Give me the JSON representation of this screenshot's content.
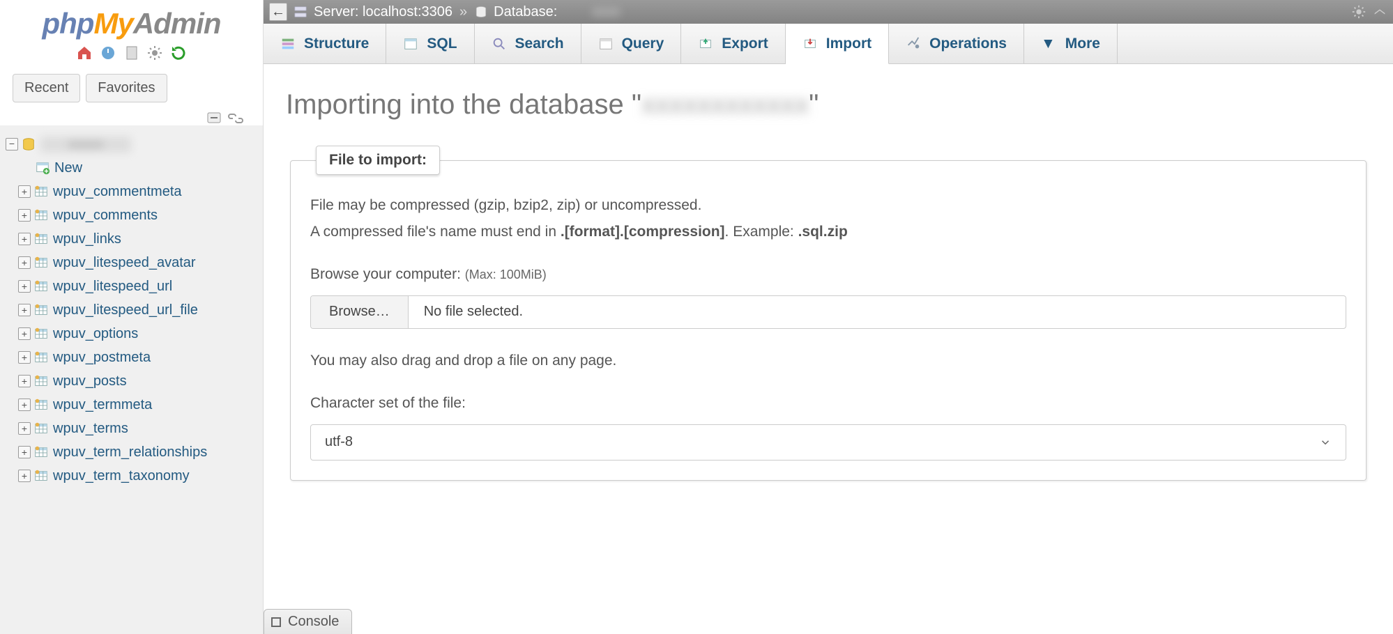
{
  "logo": {
    "p1": "php",
    "p2": "My",
    "p3": "Admin"
  },
  "sidebar": {
    "tabs": {
      "recent": "Recent",
      "favorites": "Favorites"
    },
    "new_label": "New",
    "tables": [
      "wpuv_commentmeta",
      "wpuv_comments",
      "wpuv_links",
      "wpuv_litespeed_avatar",
      "wpuv_litespeed_url",
      "wpuv_litespeed_url_file",
      "wpuv_options",
      "wpuv_postmeta",
      "wpuv_posts",
      "wpuv_termmeta",
      "wpuv_terms",
      "wpuv_term_relationships",
      "wpuv_term_taxonomy"
    ]
  },
  "breadcrumb": {
    "server_label": "Server: localhost:3306",
    "db_label": "Database:"
  },
  "tabs": [
    {
      "key": "structure",
      "label": "Structure"
    },
    {
      "key": "sql",
      "label": "SQL"
    },
    {
      "key": "search",
      "label": "Search"
    },
    {
      "key": "query",
      "label": "Query"
    },
    {
      "key": "export",
      "label": "Export"
    },
    {
      "key": "import",
      "label": "Import"
    },
    {
      "key": "operations",
      "label": "Operations"
    },
    {
      "key": "more",
      "label": "More"
    }
  ],
  "page": {
    "title_prefix": "Importing into the database \"",
    "title_suffix": "\""
  },
  "import_panel": {
    "legend": "File to import:",
    "line1": "File may be compressed (gzip, bzip2, zip) or uncompressed.",
    "line2a": "A compressed file's name must end in ",
    "line2b": ".[format].[compression]",
    "line2c": ". Example: ",
    "line2d": ".sql.zip",
    "browse_label": "Browse your computer: ",
    "max_note": "(Max: 100MiB)",
    "browse_button": "Browse…",
    "no_file": "No file selected.",
    "drag_note": "You may also drag and drop a file on any page.",
    "charset_label": "Character set of the file:",
    "charset_value": "utf-8"
  },
  "console": {
    "label": "Console"
  }
}
